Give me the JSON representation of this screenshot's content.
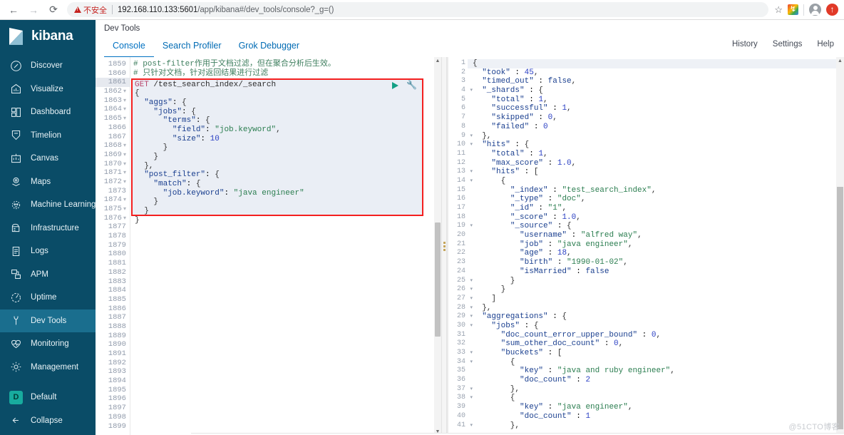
{
  "browser": {
    "back_icon": "←",
    "forward_icon": "→",
    "reload_icon": "⟳",
    "security_label": "不安全",
    "url_host": "192.168.110.133:5601",
    "url_path": "/app/kibana#/dev_tools/console?_g=()",
    "star_icon": "☆",
    "extension_icon": "extension-icon",
    "profile_icon": "profile-icon",
    "update_icon": "update-icon"
  },
  "sidebar": {
    "brand": "kibana",
    "items": [
      {
        "label": "Discover",
        "icon": "compass-icon",
        "active": false
      },
      {
        "label": "Visualize",
        "icon": "barchart-icon",
        "active": false
      },
      {
        "label": "Dashboard",
        "icon": "dashboard-icon",
        "active": false
      },
      {
        "label": "Timelion",
        "icon": "timelion-icon",
        "active": false
      },
      {
        "label": "Canvas",
        "icon": "canvas-icon",
        "active": false
      },
      {
        "label": "Maps",
        "icon": "map-pin-icon",
        "active": false
      },
      {
        "label": "Machine Learning",
        "icon": "ml-icon",
        "active": false
      },
      {
        "label": "Infrastructure",
        "icon": "infra-icon",
        "active": false
      },
      {
        "label": "Logs",
        "icon": "logs-icon",
        "active": false
      },
      {
        "label": "APM",
        "icon": "apm-icon",
        "active": false
      },
      {
        "label": "Uptime",
        "icon": "uptime-icon",
        "active": false
      },
      {
        "label": "Dev Tools",
        "icon": "wrench-icon",
        "active": true
      },
      {
        "label": "Monitoring",
        "icon": "heartbeat-icon",
        "active": false
      },
      {
        "label": "Management",
        "icon": "gear-icon",
        "active": false
      }
    ],
    "space": {
      "badge": "D",
      "label": "Default"
    },
    "collapse": {
      "icon": "arrow-left-icon",
      "label": "Collapse"
    }
  },
  "header": {
    "app_title": "Dev Tools",
    "tabs": [
      {
        "label": "Console",
        "active": true
      },
      {
        "label": "Search Profiler",
        "active": false
      },
      {
        "label": "Grok Debugger",
        "active": false
      }
    ],
    "links": [
      "History",
      "Settings",
      "Help"
    ]
  },
  "editor": {
    "first_line_number": 1859,
    "last_line_number": 1899,
    "highlighted_line": 1861,
    "fold_lines": [
      1862,
      1863,
      1864,
      1865,
      1868,
      1869,
      1870,
      1871,
      1872,
      1874,
      1875,
      1876
    ],
    "run_button": "play-icon",
    "wrench_button": "wrench-icon",
    "comments": [
      "# post-filter作用于文档过滤，但在聚合分析后生效。",
      "# 只针对文档，针对返回结果进行过滤"
    ],
    "request_method": "GET",
    "request_path": "/test_search_index/_search",
    "request_body": [
      "{",
      "  \"aggs\": {",
      "    \"jobs\": {",
      "      \"terms\": {",
      "        \"field\": \"job.keyword\",",
      "        \"size\": 10",
      "      }",
      "    }",
      "  },",
      "  \"post_filter\": {",
      "    \"match\": {",
      "      \"job.keyword\": \"java engineer\"",
      "    }",
      "  }",
      "}"
    ]
  },
  "response": {
    "first_line_number": 1,
    "last_line_number": 41,
    "fold_lines": [
      1,
      4,
      9,
      10,
      13,
      14,
      19,
      25,
      26,
      27,
      28,
      29,
      30,
      33,
      34,
      37,
      38,
      41
    ],
    "lines": [
      "{",
      "  \"took\" : 45,",
      "  \"timed_out\" : false,",
      "  \"_shards\" : {",
      "    \"total\" : 1,",
      "    \"successful\" : 1,",
      "    \"skipped\" : 0,",
      "    \"failed\" : 0",
      "  },",
      "  \"hits\" : {",
      "    \"total\" : 1,",
      "    \"max_score\" : 1.0,",
      "    \"hits\" : [",
      "      {",
      "        \"_index\" : \"test_search_index\",",
      "        \"_type\" : \"doc\",",
      "        \"_id\" : \"1\",",
      "        \"_score\" : 1.0,",
      "        \"_source\" : {",
      "          \"username\" : \"alfred way\",",
      "          \"job\" : \"java engineer\",",
      "          \"age\" : 18,",
      "          \"birth\" : \"1990-01-02\",",
      "          \"isMarried\" : false",
      "        }",
      "      }",
      "    ]",
      "  },",
      "  \"aggregations\" : {",
      "    \"jobs\" : {",
      "      \"doc_count_error_upper_bound\" : 0,",
      "      \"sum_other_doc_count\" : 0,",
      "      \"buckets\" : [",
      "        {",
      "          \"key\" : \"java and ruby engineer\",",
      "          \"doc_count\" : 2",
      "        },",
      "        {",
      "          \"key\" : \"java engineer\",",
      "          \"doc_count\" : 1",
      "        },"
    ]
  },
  "watermark": "@51CTO博客",
  "colors": {
    "sidebar_bg": "#0a4c67",
    "sidebar_active": "#1a6e8e",
    "accent": "#0071c2",
    "run_green": "#13a085",
    "highlight_box": "#f41f1f",
    "space_badge": "#18ab9e"
  }
}
